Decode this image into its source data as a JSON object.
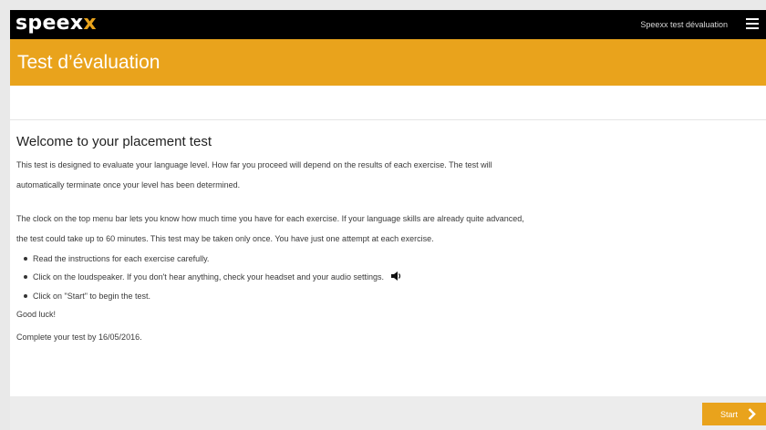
{
  "topbar": {
    "logo_main": "speex",
    "logo_accent": "x",
    "title": "Speexx test dévaluation",
    "menu_icon": "hamburger-menu-icon"
  },
  "banner": {
    "title": "Test d’évaluation"
  },
  "content": {
    "heading": "Welcome to your placement test",
    "para1_line1": "This test is designed to evaluate your language level. How far you proceed will depend on the results of each exercise. The test will",
    "para1_line2": "automatically terminate once your level has been determined.",
    "para2_line1": "The clock on the top menu bar lets you know how much time you have for each exercise. If your language skills are already quite advanced,",
    "para2_line2": "the test could take up to 60 minutes. This test may be taken only once. You have just one attempt at each exercise.",
    "bullets": [
      "Read the instructions for each exercise carefully.",
      "Click on the loudspeaker. If you don't hear anything, check your headset and your audio settings.",
      "Click on \"Start\" to begin the test."
    ],
    "speaker_icon": "speaker-icon",
    "good_luck": "Good luck!",
    "complete_by": "Complete your test by 16/05/2016."
  },
  "footer": {
    "start_label": "Start",
    "start_icon": "chevron-right-icon"
  },
  "colors": {
    "accent": "#e9a31c",
    "topbar": "#000000",
    "footer": "#ececec"
  }
}
